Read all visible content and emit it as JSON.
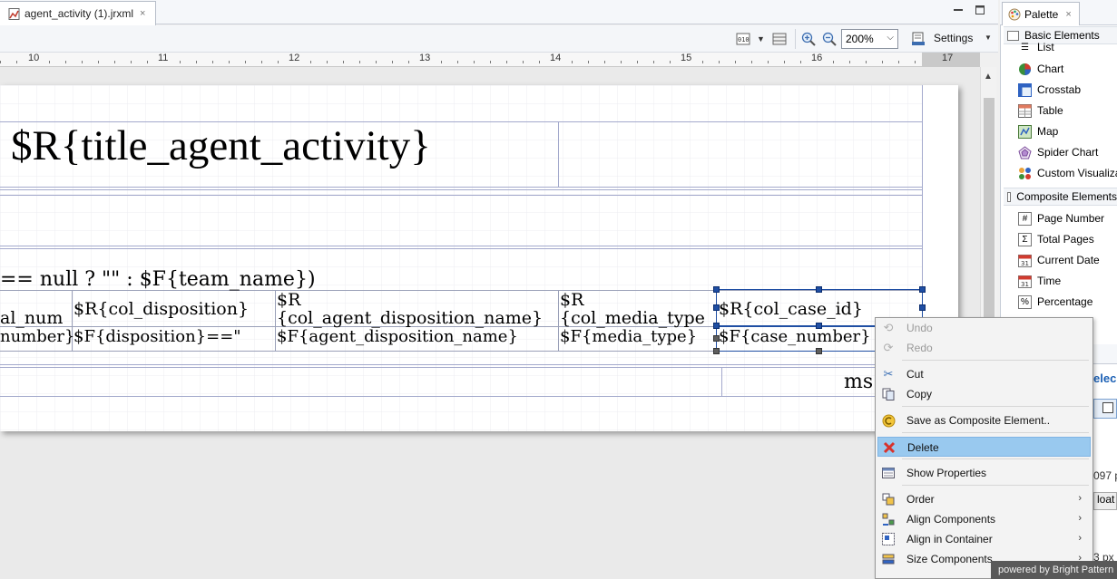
{
  "editor": {
    "tab_label": "agent_activity (1).jrxml",
    "close_glyph": "×",
    "minimize_glyph": "▭",
    "maximize_glyph": "□"
  },
  "toolbar": {
    "zoom_value": "200%",
    "settings_label": "Settings"
  },
  "ruler": {
    "labels": [
      "10",
      "11",
      "12",
      "13",
      "14",
      "15",
      "16",
      "17"
    ]
  },
  "report": {
    "title": "$R{title_agent_activity}",
    "team_expression": "== null ? \"\" : $F{team_name})",
    "headers": {
      "agent_num": "al_num",
      "disposition": "$R{col_disposition}",
      "agent_disposition_line1": "$R",
      "agent_disposition_line2": "{col_agent_disposition_name}",
      "media_type_line1": "$R",
      "media_type_line2": "{col_media_type",
      "case_id": "$R{col_case_id}"
    },
    "fields": {
      "number": "number}",
      "disposition": "$F{disposition}==\"",
      "agent_disposition_name": "$F{agent_disposition_name}",
      "media_type": "$F{media_type}",
      "case_number": "$F{case_number}"
    },
    "footer_text": "ms"
  },
  "palette": {
    "tab_label": "Palette",
    "categories": {
      "basic": "Basic Elements",
      "composite": "Composite Elements"
    },
    "basic_items": [
      "List",
      "Chart",
      "Crosstab",
      "Table",
      "Map",
      "Spider Chart",
      "Custom Visualization"
    ],
    "composite_items": [
      "Page Number",
      "Total Pages",
      "Current Date",
      "Time",
      "Percentage"
    ]
  },
  "properties": {
    "header_fragment": "elec",
    "value_fragment": "097 p",
    "button_fragment": "loat",
    "value_fragment2": "3 px"
  },
  "context_menu": {
    "undo": "Undo",
    "redo": "Redo",
    "cut": "Cut",
    "copy": "Copy",
    "save_composite": "Save as Composite Element..",
    "delete": "Delete",
    "show_properties": "Show Properties",
    "order": "Order",
    "align_components": "Align Components",
    "align_container": "Align in Container",
    "size_components": "Size Components"
  },
  "watermark": "powered by Bright Pattern"
}
